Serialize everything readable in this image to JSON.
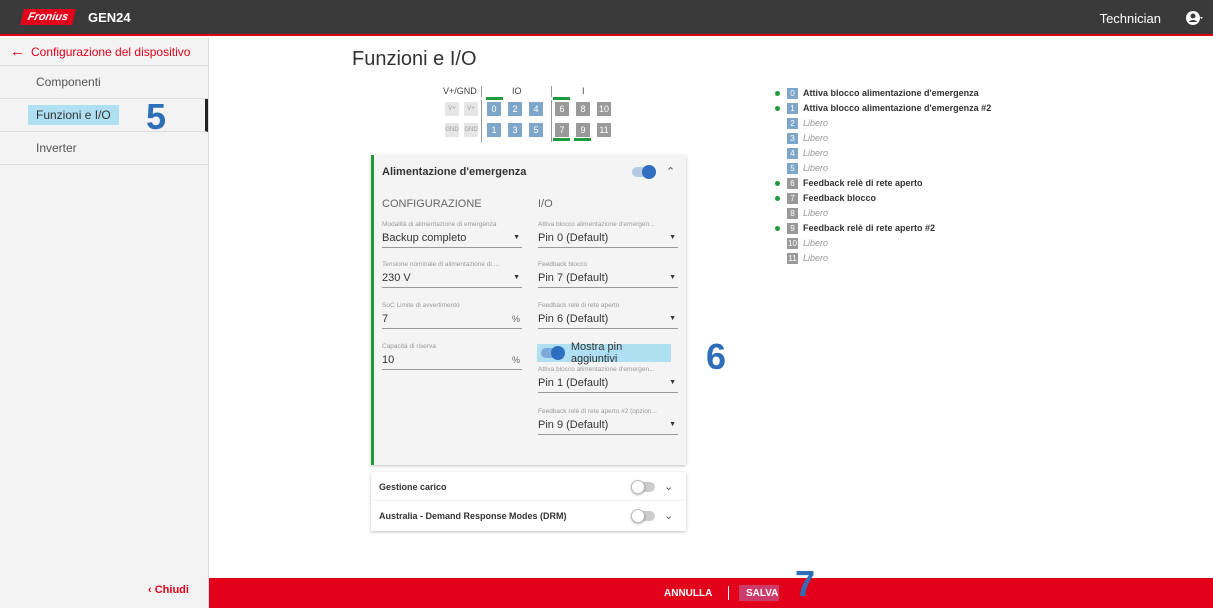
{
  "header": {
    "brand": "Fronius",
    "product": "GEN24",
    "user": "Technician"
  },
  "sidebar": {
    "back_label": "Configurazione del dispositivo",
    "items": [
      {
        "label": "Componenti"
      },
      {
        "label": "Funzioni e I/O",
        "active": true
      },
      {
        "label": "Inverter"
      }
    ],
    "close_label": "‹ Chiudi"
  },
  "annotations": {
    "n5": "5",
    "n6": "6",
    "n7": "7"
  },
  "main": {
    "title": "Funzioni e I/O",
    "pin_headers": {
      "vgnd": "V+/GND",
      "io": "IO",
      "i": "I"
    },
    "pins_top": [
      "V+",
      "V+",
      "0",
      "2",
      "4",
      "6",
      "8",
      "10"
    ],
    "pins_bottom": [
      "GND",
      "GND",
      "1",
      "3",
      "5",
      "7",
      "9",
      "11"
    ]
  },
  "emergency_card": {
    "title": "Alimentazione d'emergenza",
    "enabled": true,
    "config_header": "CONFIGURAZIONE",
    "io_header": "I/O",
    "mode_label": "Modalità di alimentazione di emergenza",
    "mode_value": "Backup completo",
    "voltage_label": "Tensione nominale di alimentazione di ...",
    "voltage_value": "230 V",
    "soc_label": "SoC Limite di avvertimento",
    "soc_value": "7",
    "soc_unit": "%",
    "reserve_label": "Capacità di riserva",
    "reserve_value": "10",
    "reserve_unit": "%",
    "io1_label": "Attiva blocco alimentazione d'emergen...",
    "io1_value": "Pin 0 (Default)",
    "io2_label": "Feedback blocco",
    "io2_value": "Pin 7 (Default)",
    "io3_label": "Feedback relè di rete aperto",
    "io3_value": "Pin 6 (Default)",
    "show_pins_label": "Mostra pin aggiuntivi",
    "io4_label": "Attiva blocco alimentazione d'emergen...",
    "io4_value": "Pin 1 (Default)",
    "io5_label": "Feedback relè di rete aperto #2 (opzion...",
    "io5_value": "Pin 9 (Default)"
  },
  "other_cards": [
    {
      "title": "Gestione carico",
      "enabled": false
    },
    {
      "title": "Australia - Demand Response Modes (DRM)",
      "enabled": false
    }
  ],
  "pin_list": [
    {
      "num": "0",
      "label": "Attiva blocco alimentazione d'emergenza",
      "used": true
    },
    {
      "num": "1",
      "label": "Attiva blocco alimentazione d'emergenza #2",
      "used": true
    },
    {
      "num": "2",
      "label": "Libero",
      "used": false
    },
    {
      "num": "3",
      "label": "Libero",
      "used": false
    },
    {
      "num": "4",
      "label": "Libero",
      "used": false
    },
    {
      "num": "5",
      "label": "Libero",
      "used": false
    },
    {
      "num": "6",
      "label": "Feedback relè di rete aperto",
      "used": true
    },
    {
      "num": "7",
      "label": "Feedback blocco",
      "used": true
    },
    {
      "num": "8",
      "label": "Libero",
      "used": false
    },
    {
      "num": "9",
      "label": "Feedback relè di rete aperto #2",
      "used": true
    },
    {
      "num": "10",
      "label": "Libero",
      "used": false
    },
    {
      "num": "11",
      "label": "Libero",
      "used": false
    }
  ],
  "footer": {
    "cancel_label": "ANNULLA",
    "save_label": "SALVA"
  },
  "colors": {
    "brand": "#e2001a",
    "active_green": "#1e9b3a",
    "highlight": "#aee0f2"
  }
}
